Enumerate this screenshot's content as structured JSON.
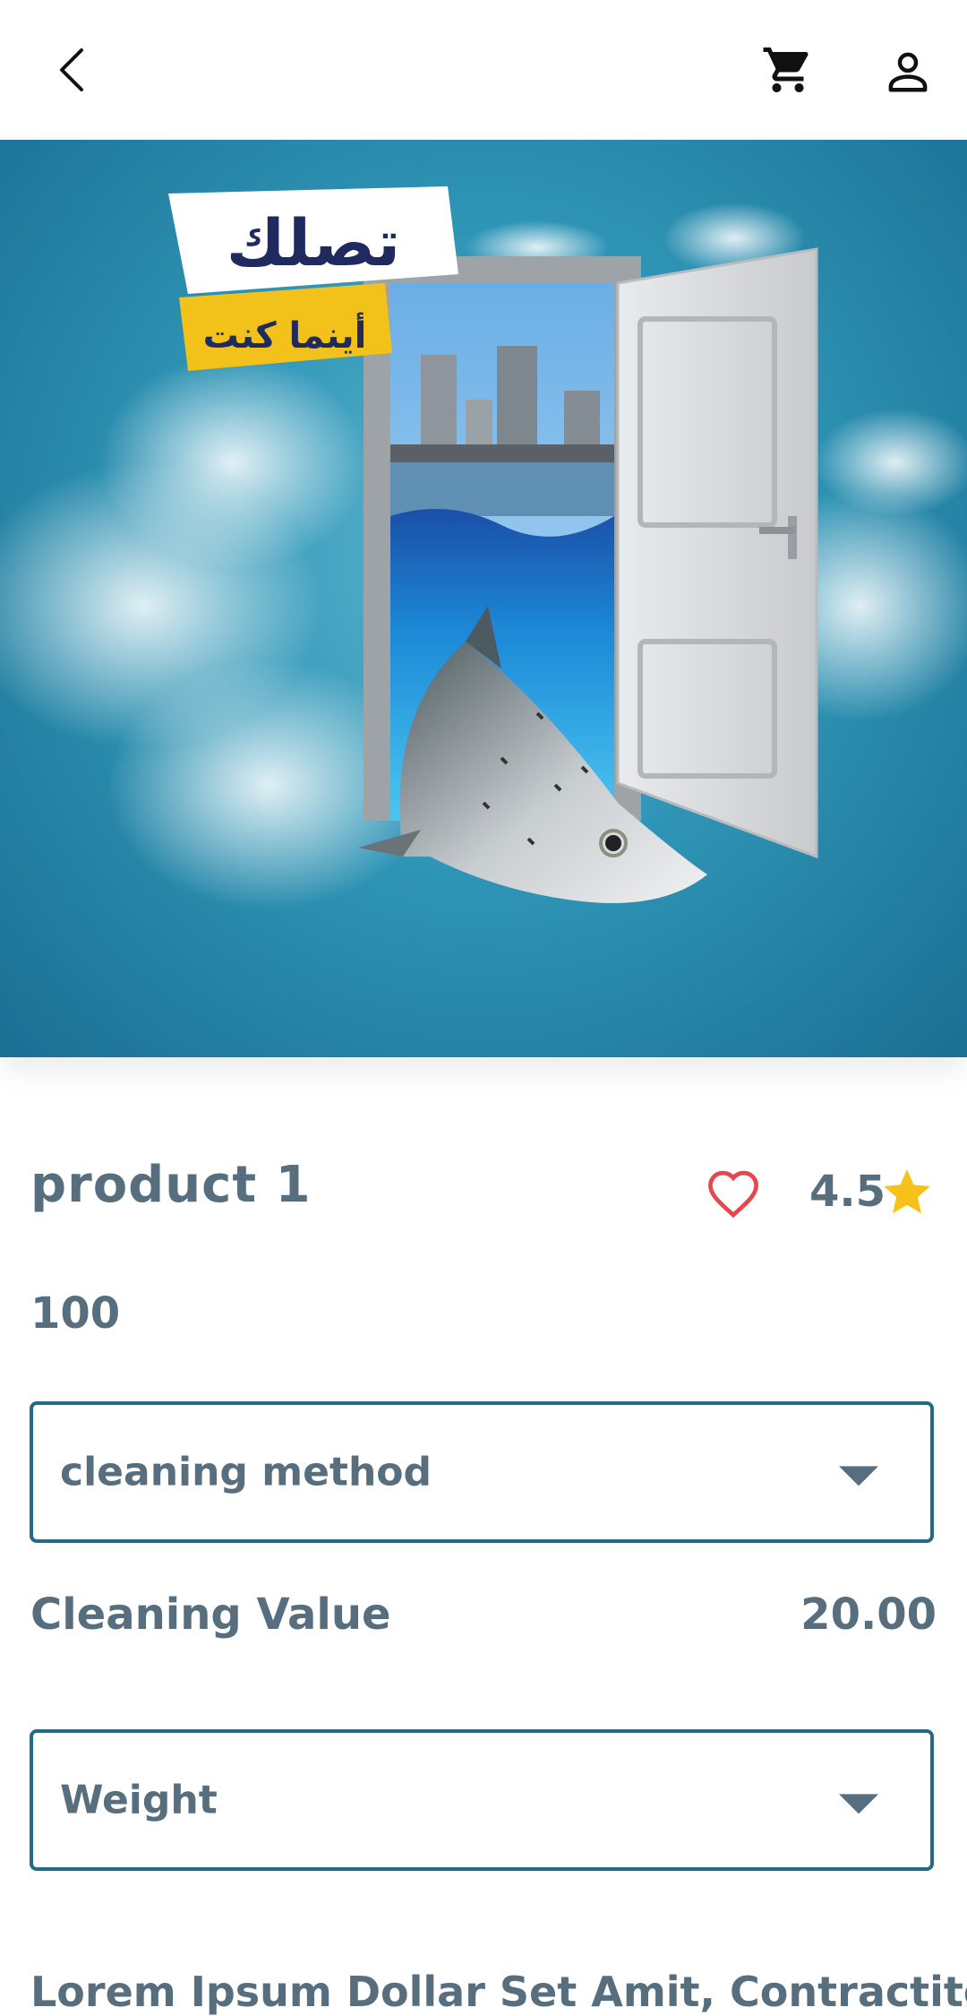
{
  "header": {
    "back_icon": "chevron-left-icon",
    "cart_icon": "shopping-cart-icon",
    "profile_icon": "user-icon"
  },
  "hero": {
    "banner_line1": "تصلك",
    "banner_line2": "أينما كنت"
  },
  "product": {
    "name": "product 1",
    "rating": "4.5",
    "price": "100"
  },
  "options": {
    "cleaning_method_label": "cleaning method",
    "cleaning_value_label": "Cleaning Value",
    "cleaning_value": "20.00",
    "weight_label": "Weight"
  },
  "description": "Lorem Ipsum Dollar Set Amit, Contractitor",
  "colors": {
    "accent": "#226a86",
    "text": "#566e7e",
    "heart": "#e4484f",
    "star": "#f6c21a"
  }
}
